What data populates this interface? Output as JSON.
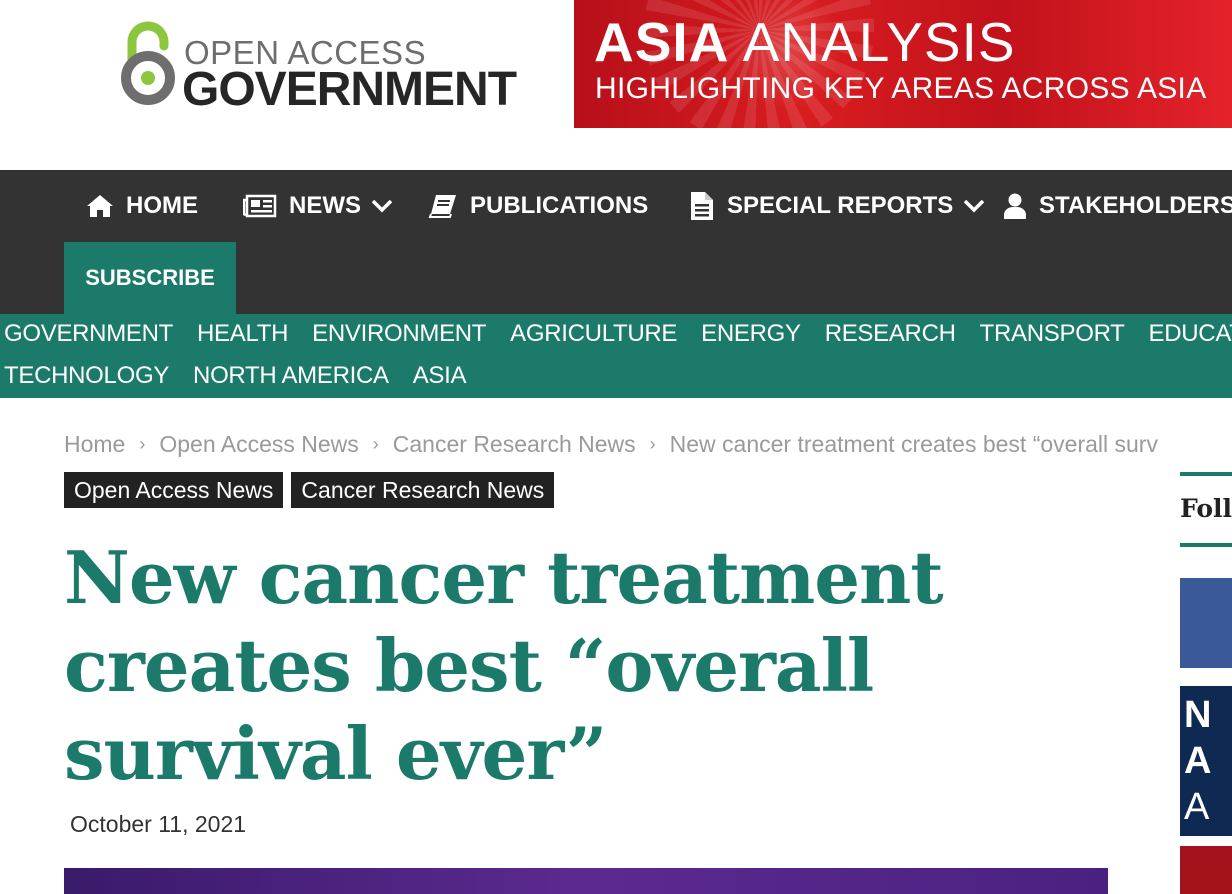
{
  "logo": {
    "line1": "OPEN ACCESS",
    "line2": "GOVERNMENT",
    "colors": {
      "green": "#8cc63f",
      "grey": "#6e6e6e",
      "dark": "#262626"
    }
  },
  "banner": {
    "title_bold": "ASIA",
    "title_light": " ANALYSIS",
    "subtitle": "HIGHLIGHTING KEY AREAS ACROSS ASIA",
    "color": "#d81d20"
  },
  "nav": {
    "items": [
      {
        "label": "HOME",
        "icon": "home-icon"
      },
      {
        "label": "NEWS",
        "icon": "newspaper-icon",
        "has_dropdown": true
      },
      {
        "label": "PUBLICATIONS",
        "icon": "book-icon"
      },
      {
        "label": "SPECIAL REPORTS",
        "icon": "document-icon",
        "has_dropdown": true
      },
      {
        "label": "STAKEHOLDERS",
        "icon": "user-icon"
      }
    ],
    "subscribe_label": "SUBSCRIBE",
    "background": "#333333"
  },
  "categories": {
    "row1": [
      "GOVERNMENT",
      "HEALTH",
      "ENVIRONMENT",
      "AGRICULTURE",
      "ENERGY",
      "RESEARCH",
      "TRANSPORT",
      "EDUCATIO"
    ],
    "row2": [
      "TECHNOLOGY",
      "NORTH AMERICA",
      "ASIA"
    ],
    "background": "#1b7a69"
  },
  "breadcrumb": {
    "items": [
      "Home",
      "Open Access News",
      "Cancer Research News",
      "New cancer treatment creates best “overall surv"
    ]
  },
  "article": {
    "tags": [
      "Open Access News",
      "Cancer Research News"
    ],
    "title_lines": [
      "New cancer treatment",
      "creates best “overall",
      "survival ever”"
    ],
    "date": "October 11, 2021",
    "accent": "#1b7a69"
  },
  "rail": {
    "follow_label": "Follo",
    "box2_lines": [
      "N",
      "A",
      "A"
    ]
  }
}
